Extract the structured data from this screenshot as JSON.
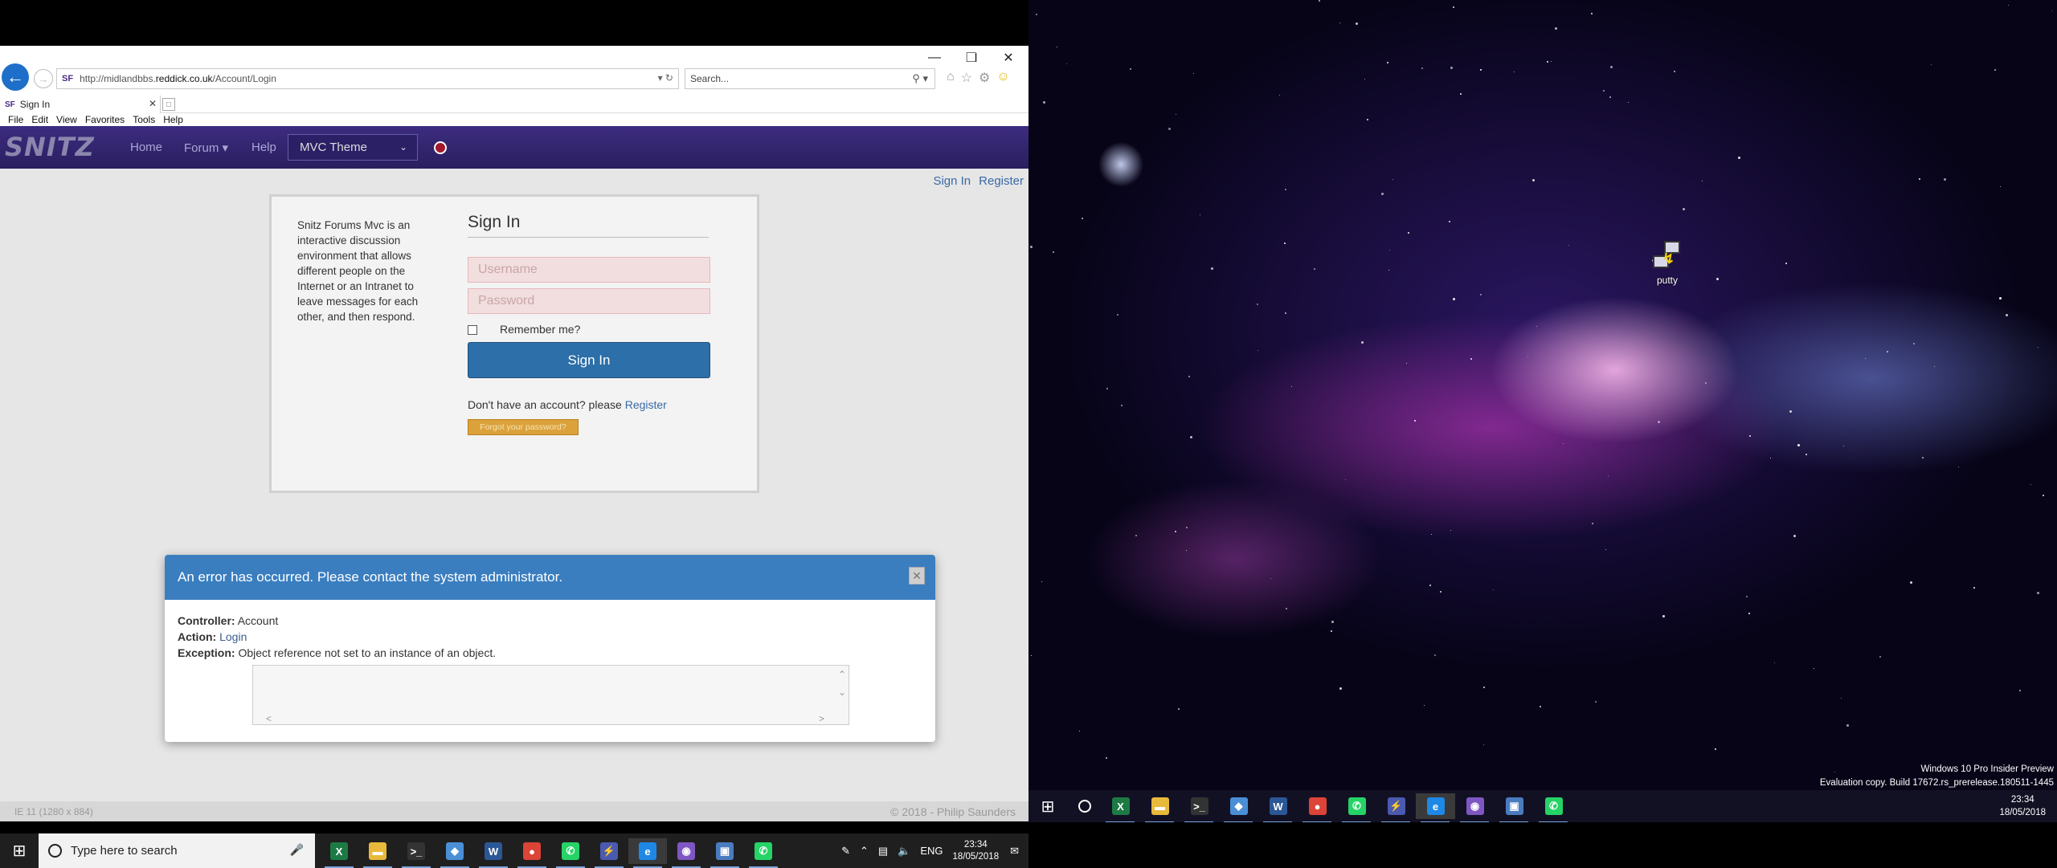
{
  "browser": {
    "url_prefix": "http://midlandbbs.",
    "url_domain": "reddick.co.uk",
    "url_path": "/Account/Login",
    "favicon": "SF",
    "search_placeholder": "Search...",
    "tab_title": "Sign In",
    "menu": [
      "File",
      "Edit",
      "View",
      "Favorites",
      "Tools",
      "Help"
    ],
    "zoom_status": "IE 11 (1280 x 884)"
  },
  "site": {
    "logo": "SNITZ",
    "nav": [
      "Home",
      "Forum",
      "Help"
    ],
    "theme_selected": "MVC Theme",
    "auth_links": [
      "Sign In",
      "Register"
    ],
    "about_text": "Snitz Forums Mvc is an interactive discussion environment that allows different people on the Internet or an Intranet to leave messages for each other, and then respond.",
    "signin_title": "Sign In",
    "username_placeholder": "Username",
    "password_placeholder": "Password",
    "remember_label": "Remember me?",
    "signin_button": "Sign In",
    "no_account_text": "Don't have an account? please ",
    "register_link": "Register",
    "forgot_button": "Forgot your password?",
    "copyright": "© 2018 - Philip Saunders"
  },
  "error_dialog": {
    "title": "An error has occurred. Please contact the system administrator.",
    "controller_label": "Controller:",
    "controller_value": "Account",
    "action_label": "Action:",
    "action_value": "Login",
    "exception_label": "Exception:",
    "exception_value": "Object reference not set to an instance of an object."
  },
  "taskbar_left": {
    "search_placeholder": "Type here to search",
    "language": "ENG",
    "time": "23:34",
    "date": "18/05/2018",
    "apps": [
      {
        "icon": "excel-icon",
        "glyph": "X",
        "color": "#1d7a45"
      },
      {
        "icon": "file-explorer-icon",
        "glyph": "▬",
        "color": "#e8b93a"
      },
      {
        "icon": "terminal-icon",
        "glyph": ">_",
        "color": "#333333"
      },
      {
        "icon": "remote-app-icon",
        "glyph": "◆",
        "color": "#4a8fd6"
      },
      {
        "icon": "word-icon",
        "glyph": "W",
        "color": "#2b5797"
      },
      {
        "icon": "chrome-icon",
        "glyph": "●",
        "color": "#db4437"
      },
      {
        "icon": "whatsapp-icon",
        "glyph": "✆",
        "color": "#25d366"
      },
      {
        "icon": "putty-icon",
        "glyph": "⚡",
        "color": "#4a5ab0"
      },
      {
        "icon": "internet-explorer-icon",
        "glyph": "e",
        "color": "#1e88e5"
      },
      {
        "icon": "tor-browser-icon",
        "glyph": "◉",
        "color": "#7e57c2"
      },
      {
        "icon": "remote-desktop-icon",
        "glyph": "▣",
        "color": "#4a7bbf"
      },
      {
        "icon": "whatsapp-icon",
        "glyph": "✆",
        "color": "#25d366"
      }
    ]
  },
  "desktop": {
    "icon_label": "putty",
    "watermark_line1": "Windows 10 Pro Insider Preview",
    "watermark_line2": "Evaluation copy. Build 17672.rs_prerelease.180511-1445",
    "time": "23:34",
    "date": "18/05/2018"
  }
}
